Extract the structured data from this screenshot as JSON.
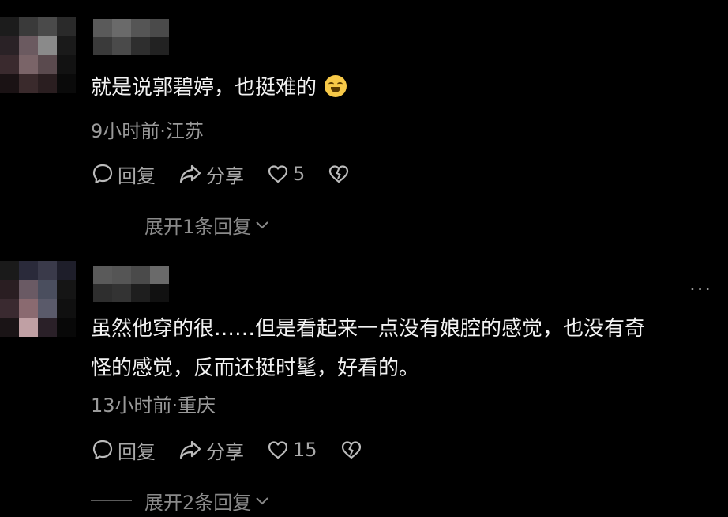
{
  "comments": [
    {
      "text": "就是说郭碧婷，也挺难的",
      "emoji": "grin-sweat-emoji",
      "meta": "9小时前·江苏",
      "reply_label": "回复",
      "share_label": "分享",
      "like_count": "5",
      "expand_label": "展开1条回复"
    },
    {
      "text_line1": "虽然他穿的很……但是看起来一点没有娘腔的感觉，也没有奇",
      "text_line2": "怪的感觉，反而还挺时髦，好看的。",
      "meta": "13小时前·重庆",
      "reply_label": "回复",
      "share_label": "分享",
      "like_count": "15",
      "expand_label": "展开2条回复",
      "more_label": "···"
    }
  ],
  "colors": {
    "background": "#000000",
    "primary_text": "#f2f2f2",
    "secondary_text": "#9a9a9a"
  }
}
